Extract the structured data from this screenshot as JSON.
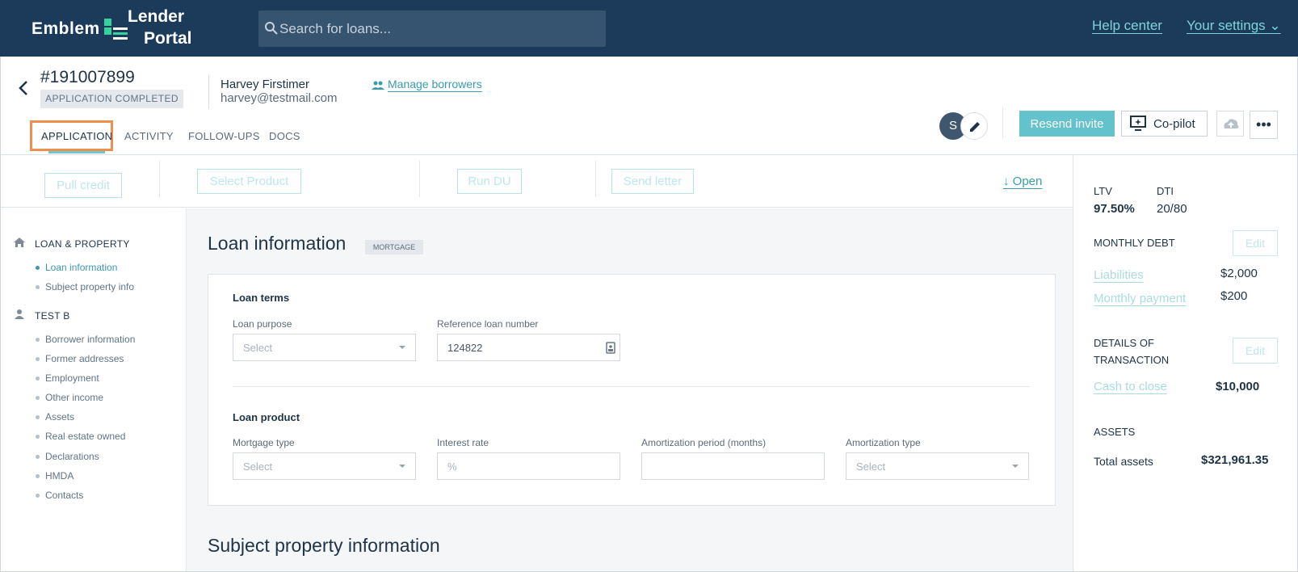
{
  "header": {
    "logo_left": "Emblem",
    "logo_line1": "Lender",
    "logo_line2": "Portal",
    "search_placeholder": "Search for loans...",
    "help_center": "Help center",
    "your_settings": "Your settings ⌄"
  },
  "loan": {
    "id": "#191007899",
    "status": "APPLICATION COMPLETED",
    "borrower_name": "Harvey Firstimer",
    "borrower_email": "harvey@testmail.com",
    "manage_borrowers": "Manage borrowers"
  },
  "tabs": [
    "APPLICATION",
    "ACTIVITY",
    "FOLLOW-UPS",
    "DOCS"
  ],
  "toolbar": {
    "avatar_initial": "S",
    "resend_invite": "Resend invite",
    "copilot": "Co-pilot",
    "more": "•••"
  },
  "actions": {
    "pull_credit": "Pull credit",
    "select_product": "Select Product",
    "run_du": "Run DU",
    "send_letter": "Send letter",
    "open": "↓ Open"
  },
  "sidebar": {
    "section1": "LOAN & PROPERTY",
    "section1_items": [
      "Loan information",
      "Subject property info"
    ],
    "section2": "TEST B",
    "section2_items": [
      "Borrower information",
      "Former addresses",
      "Employment",
      "Other income",
      "Assets",
      "Real estate owned",
      "Declarations",
      "HMDA",
      "Contacts"
    ]
  },
  "main": {
    "title": "Loan information",
    "tag": "MORTGAGE",
    "loan_terms_title": "Loan terms",
    "loan_purpose_label": "Loan purpose",
    "loan_purpose_value": "Select",
    "ref_loan_label": "Reference loan number",
    "ref_loan_value": "124822",
    "loan_product_title": "Loan product",
    "mortgage_type_label": "Mortgage type",
    "mortgage_type_value": "Select",
    "interest_rate_label": "Interest rate",
    "interest_rate_placeholder": "%",
    "amort_period_label": "Amortization period (months)",
    "amort_type_label": "Amortization type",
    "amort_type_value": "Select",
    "subject_title": "Subject property information"
  },
  "right_panel": {
    "ltv_label": "LTV",
    "ltv_value": "97.50%",
    "dti_label": "DTI",
    "dti_value": "20/80",
    "monthly_debt": "MONTHLY DEBT",
    "edit": "Edit",
    "liabilities_label": "Liabilities",
    "liabilities_value": "$2,000",
    "monthly_payment_label": "Monthly payment",
    "monthly_payment_value": "$200",
    "details_line1": "DETAILS OF",
    "details_line2": "TRANSACTION",
    "cash_to_close_label": "Cash to close",
    "cash_to_close_value": "$10,000",
    "assets": "ASSETS",
    "total_assets_label": "Total assets",
    "total_assets_value": "$321,961.35"
  },
  "colors": {
    "header_bg": "#1c3b5a",
    "accent_teal": "#63c2cb",
    "link_teal": "#389caf",
    "highlight_orange": "#ee8f4e"
  }
}
